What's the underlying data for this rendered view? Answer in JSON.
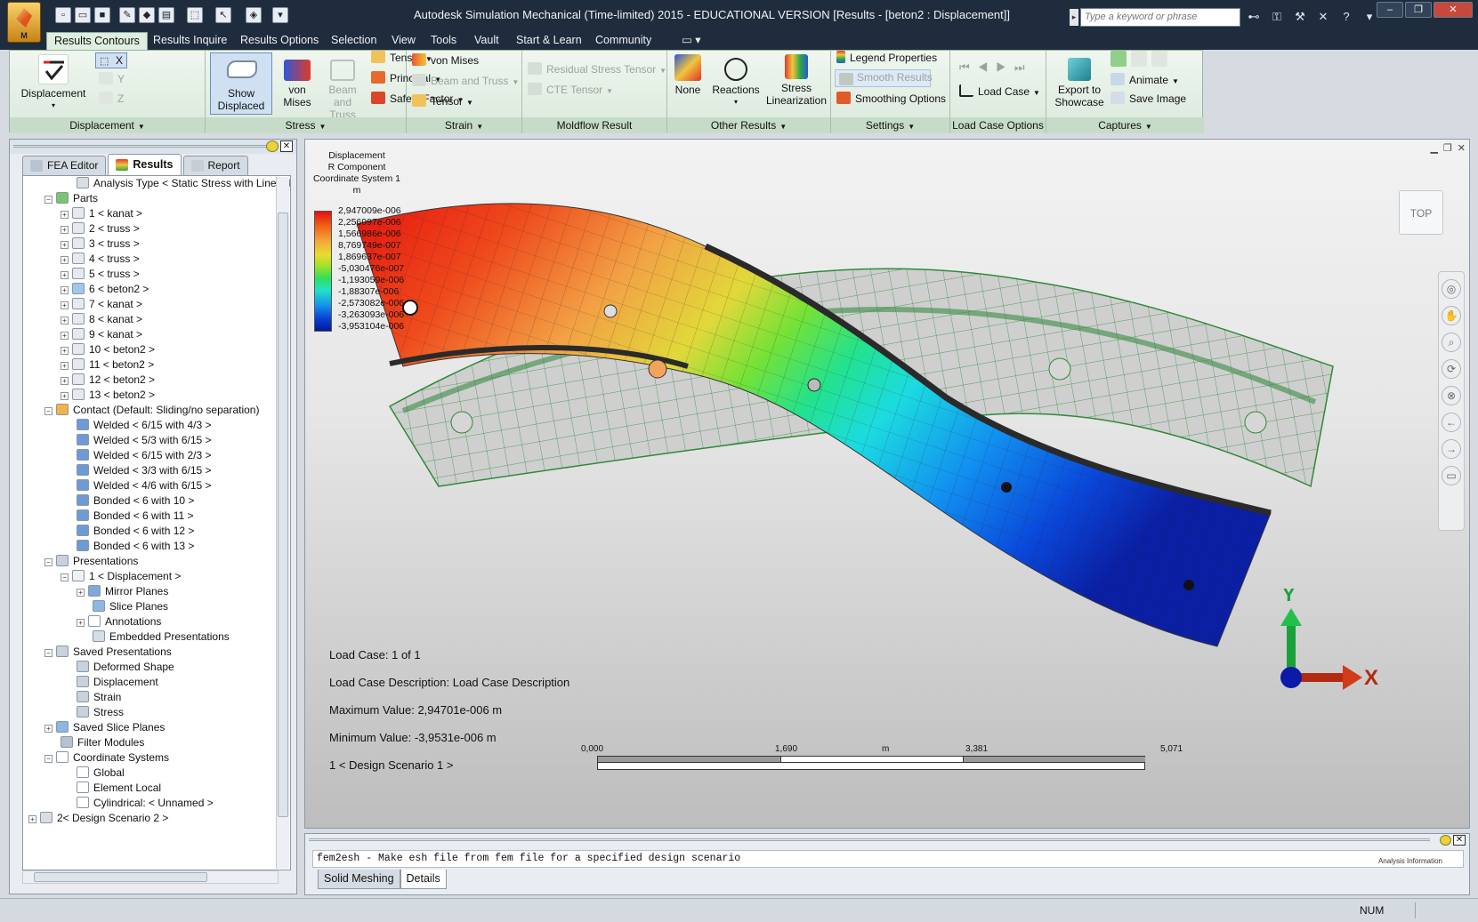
{
  "window": {
    "title": "Autodesk Simulation Mechanical (Time-limited) 2015 - EDUCATIONAL VERSION      [Results - [beton2 : Displacement]]",
    "search_placeholder": "Type a keyword or phrase",
    "app_button_label": "M",
    "controls": [
      "–",
      "❐",
      "✕"
    ]
  },
  "ribbon_tabs": [
    "Results Contours",
    "Results Inquire",
    "Results Options",
    "Selection",
    "View",
    "Tools",
    "Vault",
    "Start & Learn",
    "Community"
  ],
  "ribbon": {
    "displacement": {
      "label": "Displacement",
      "big": "Displacement",
      "axes": [
        "X",
        "Y",
        "Z"
      ]
    },
    "stress": {
      "label": "Stress",
      "show_displaced": "Show Displaced",
      "von_mises": "von Mises",
      "beam_truss": "Beam and Truss",
      "tensor": "Tensor",
      "principal": "Principal",
      "safety_factor": "Safety Factor"
    },
    "strain": {
      "label": "Strain",
      "von_mises": "von Mises",
      "beam_truss": "Beam and Truss",
      "tensor": "Tensor"
    },
    "moldflow": {
      "label": "Moldflow Result",
      "residual": "Residual Stress Tensor",
      "cte": "CTE Tensor"
    },
    "other": {
      "label": "Other Results",
      "none": "None",
      "reactions": "Reactions",
      "stress_lin": "Stress Linearization"
    },
    "settings": {
      "label": "Settings",
      "legend_props": "Legend Properties",
      "smooth": "Smooth Results",
      "smoothing_opts": "Smoothing Options"
    },
    "load_case": {
      "label": "Load Case Options",
      "load_case": "Load Case"
    },
    "captures": {
      "label": "Captures",
      "export": "Export to Showcase",
      "animate": "Animate",
      "save_image": "Save Image"
    }
  },
  "left_panel": {
    "tabs": [
      "FEA Editor",
      "Results",
      "Report"
    ],
    "tree": [
      {
        "label": "Analysis Type < Static Stress with Linear Ma",
        "indent": 2,
        "exp": "",
        "icon": "doc"
      },
      {
        "label": "Parts",
        "indent": 1,
        "exp": "−",
        "icon": "parts"
      },
      {
        "label": "1 < kanat >",
        "indent": 2,
        "exp": "+",
        "icon": "part"
      },
      {
        "label": "2 < truss >",
        "indent": 2,
        "exp": "+",
        "icon": "part"
      },
      {
        "label": "3 < truss >",
        "indent": 2,
        "exp": "+",
        "icon": "part"
      },
      {
        "label": "4 < truss >",
        "indent": 2,
        "exp": "+",
        "icon": "part"
      },
      {
        "label": "5 < truss >",
        "indent": 2,
        "exp": "+",
        "icon": "part"
      },
      {
        "label": "6 < beton2 >",
        "indent": 2,
        "exp": "+",
        "icon": "part-sel"
      },
      {
        "label": "7 < kanat >",
        "indent": 2,
        "exp": "+",
        "icon": "part"
      },
      {
        "label": "8 < kanat >",
        "indent": 2,
        "exp": "+",
        "icon": "part"
      },
      {
        "label": "9 < kanat >",
        "indent": 2,
        "exp": "+",
        "icon": "part"
      },
      {
        "label": "10 < beton2 >",
        "indent": 2,
        "exp": "+",
        "icon": "part"
      },
      {
        "label": "11 < beton2 >",
        "indent": 2,
        "exp": "+",
        "icon": "part"
      },
      {
        "label": "12 < beton2 >",
        "indent": 2,
        "exp": "+",
        "icon": "part"
      },
      {
        "label": "13 < beton2 >",
        "indent": 2,
        "exp": "+",
        "icon": "part"
      },
      {
        "label": "Contact (Default: Sliding/no separation)",
        "indent": 1,
        "exp": "−",
        "icon": "contact"
      },
      {
        "label": "Welded < 6/15 with 4/3 >",
        "indent": 2,
        "exp": "",
        "icon": "weld"
      },
      {
        "label": "Welded < 5/3 with 6/15 >",
        "indent": 2,
        "exp": "",
        "icon": "weld"
      },
      {
        "label": "Welded < 6/15 with 2/3 >",
        "indent": 2,
        "exp": "",
        "icon": "weld"
      },
      {
        "label": "Welded < 3/3 with 6/15 >",
        "indent": 2,
        "exp": "",
        "icon": "weld"
      },
      {
        "label": "Welded < 4/6 with 6/15 >",
        "indent": 2,
        "exp": "",
        "icon": "weld"
      },
      {
        "label": "Bonded < 6 with 10 >",
        "indent": 2,
        "exp": "",
        "icon": "weld"
      },
      {
        "label": "Bonded < 6 with 11 >",
        "indent": 2,
        "exp": "",
        "icon": "weld"
      },
      {
        "label": "Bonded < 6 with 12 >",
        "indent": 2,
        "exp": "",
        "icon": "weld"
      },
      {
        "label": "Bonded < 6 with 13 >",
        "indent": 2,
        "exp": "",
        "icon": "weld"
      },
      {
        "label": "Presentations",
        "indent": 1,
        "exp": "−",
        "icon": "pres"
      },
      {
        "label": "1 < Displacement >",
        "indent": 2,
        "exp": "−",
        "icon": "box"
      },
      {
        "label": "Mirror Planes",
        "indent": 3,
        "exp": "+",
        "icon": "mirror"
      },
      {
        "label": "Slice Planes",
        "indent": 3,
        "exp": "",
        "icon": "slice"
      },
      {
        "label": "Annotations",
        "indent": 3,
        "exp": "+",
        "icon": "annot"
      },
      {
        "label": "Embedded Presentations",
        "indent": 3,
        "exp": "",
        "icon": "embed"
      },
      {
        "label": "Saved Presentations",
        "indent": 1,
        "exp": "−",
        "icon": "pres"
      },
      {
        "label": "Deformed Shape",
        "indent": 2,
        "exp": "",
        "icon": "pres"
      },
      {
        "label": "Displacement",
        "indent": 2,
        "exp": "",
        "icon": "pres"
      },
      {
        "label": "Strain",
        "indent": 2,
        "exp": "",
        "icon": "pres"
      },
      {
        "label": "Stress",
        "indent": 2,
        "exp": "",
        "icon": "pres"
      },
      {
        "label": "Saved Slice Planes",
        "indent": 1,
        "exp": "+",
        "icon": "slice"
      },
      {
        "label": "Filter Modules",
        "indent": 1,
        "exp": "",
        "icon": "filter"
      },
      {
        "label": "Coordinate Systems",
        "indent": 1,
        "exp": "−",
        "icon": "coord"
      },
      {
        "label": "Global",
        "indent": 2,
        "exp": "",
        "icon": "coord"
      },
      {
        "label": "Element Local",
        "indent": 2,
        "exp": "",
        "icon": "coord"
      },
      {
        "label": "Cylindrical: < Unnamed >",
        "indent": 2,
        "exp": "",
        "icon": "coord"
      },
      {
        "label": "2< Design Scenario 2 >",
        "indent": 0,
        "exp": "+",
        "icon": "doc"
      }
    ]
  },
  "viewport": {
    "legend_title": [
      "Displacement",
      "R Component",
      "Coordinate System 1",
      "m"
    ],
    "legend_values": [
      "2,947009e-006",
      "2,256997e-006",
      "1,566986e-006",
      "8,769749e-007",
      "1,869637e-007",
      "-5,030476e-007",
      "-1,193059e-006",
      "-1,88307e-006",
      "-2,573082e-006",
      "-3,263093e-006",
      "-3,953104e-006"
    ],
    "view_cube_label": "TOP",
    "load_case": "Load Case:  1 of 1",
    "load_case_desc": "Load Case Description:  Load Case Description",
    "max_value": "Maximum Value: 2,94701e-006 m",
    "min_value": "Minimum Value: -3,9531e-006 m",
    "design_scenario": "1 < Design Scenario 1 >",
    "scale_labels": [
      "0,000",
      "1,690",
      "m",
      "3,381",
      "5,071"
    ],
    "triad": {
      "x": "X",
      "y": "Y"
    }
  },
  "output": {
    "text": "fem2esh - Make esh file from fem file for a specified design scenario",
    "side_label": "Analysis Information",
    "tabs": [
      "Solid Meshing",
      "Details"
    ]
  },
  "status": {
    "num": "NUM"
  }
}
